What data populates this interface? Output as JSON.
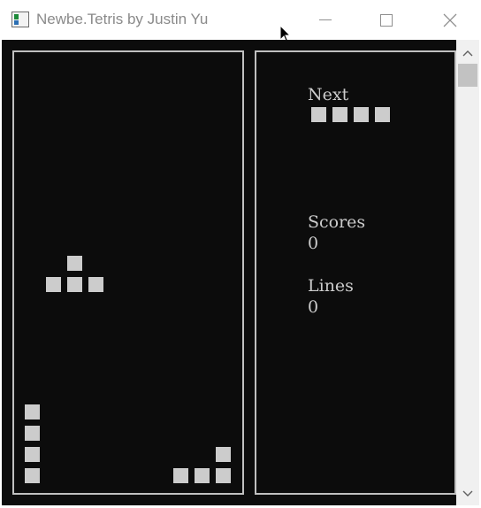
{
  "window": {
    "title": "Newbe.Tetris by Justin Yu",
    "minimize_icon": "minimize-icon",
    "maximize_icon": "maximize-icon",
    "close_icon": "close-icon"
  },
  "colors": {
    "console_bg": "#0c0c0c",
    "block": "#cccccc",
    "border": "#c0c0c0"
  },
  "game": {
    "next_label": "Next",
    "scores_label": "Scores",
    "scores_value": "0",
    "lines_label": "Lines",
    "lines_value": "0",
    "next_piece": "I",
    "falling_piece": "T",
    "placed_pieces": [
      "I (vertical)",
      "L"
    ]
  },
  "scrollbar": {
    "up_glyph": "▲",
    "down_glyph": "▼"
  }
}
